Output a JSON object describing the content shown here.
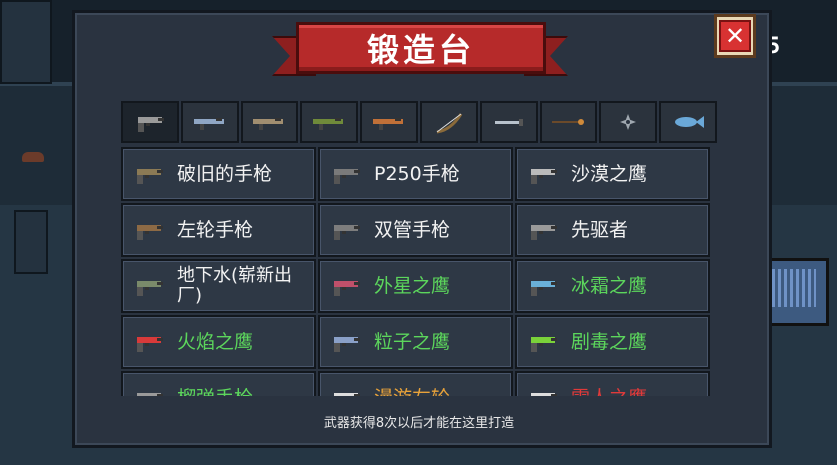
{
  "header": {
    "title": "锻造台",
    "close_label": "✕"
  },
  "hud": {
    "score": "5"
  },
  "tabs": [
    {
      "icon": "pistol-icon",
      "color": "#9a9a9a"
    },
    {
      "icon": "blaster-icon",
      "color": "#8fa6c4"
    },
    {
      "icon": "rifle-icon",
      "color": "#a18e70"
    },
    {
      "icon": "shotgun-icon",
      "color": "#6f8a3a"
    },
    {
      "icon": "launcher-icon",
      "color": "#c07038"
    },
    {
      "icon": "bow-icon",
      "color": "#8a6a3a"
    },
    {
      "icon": "sword-icon",
      "color": "#b8c2cc"
    },
    {
      "icon": "staff-icon",
      "color": "#d08a3a"
    },
    {
      "icon": "shuriken-icon",
      "color": "#a0a8b0"
    },
    {
      "icon": "fish-icon",
      "color": "#6aa8d8"
    }
  ],
  "weapons": [
    {
      "name": "破旧的手枪",
      "rarity": "white",
      "icon": "pistol-icon",
      "color": "#8b7a55"
    },
    {
      "name": "P250手枪",
      "rarity": "white",
      "icon": "pistol-icon",
      "color": "#7a7a7a"
    },
    {
      "name": "沙漠之鹰",
      "rarity": "white",
      "icon": "deagle-icon",
      "color": "#bbbbbb"
    },
    {
      "name": "左轮手枪",
      "rarity": "white",
      "icon": "revolver-icon",
      "color": "#8d6a45"
    },
    {
      "name": "双管手枪",
      "rarity": "white",
      "icon": "double-barrel-icon",
      "color": "#7d7d7d"
    },
    {
      "name": "先驱者",
      "rarity": "white",
      "icon": "pioneer-icon",
      "color": "#9a9a9a"
    },
    {
      "name": "地下水(崭新出厂)",
      "rarity": "white",
      "icon": "smg-icon",
      "color": "#7a8a6a"
    },
    {
      "name": "外星之鹰",
      "rarity": "green",
      "icon": "alien-gun-icon",
      "color": "#c0506a"
    },
    {
      "name": "冰霜之鹰",
      "rarity": "green",
      "icon": "frost-gun-icon",
      "color": "#6ab0d8"
    },
    {
      "name": "火焰之鹰",
      "rarity": "green",
      "icon": "flame-gun-icon",
      "color": "#d83a3a"
    },
    {
      "name": "粒子之鹰",
      "rarity": "green",
      "icon": "particle-gun-icon",
      "color": "#8aa0c8"
    },
    {
      "name": "剧毒之鹰",
      "rarity": "green",
      "icon": "toxic-gun-icon",
      "color": "#7ad23a"
    },
    {
      "name": "榴弹手枪",
      "rarity": "green",
      "icon": "grenade-pistol-icon",
      "color": "#9a9a9a"
    },
    {
      "name": "漫游左轮",
      "rarity": "orange",
      "icon": "roam-revolver-icon",
      "color": "#dddddd"
    },
    {
      "name": "雪人之鹰",
      "rarity": "red",
      "icon": "snowman-gun-icon",
      "color": "#dddddd"
    }
  ],
  "footer": {
    "hint": "武器获得8次以后才能在这里打造"
  }
}
